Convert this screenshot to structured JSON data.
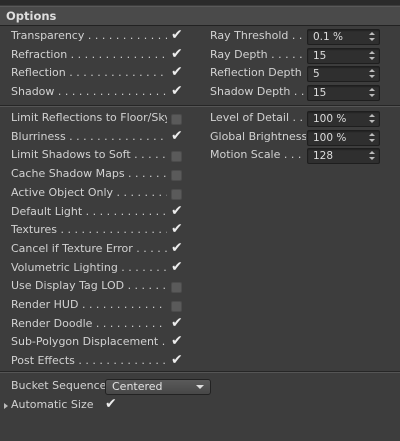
{
  "header": {
    "title": "Options"
  },
  "left_options": [
    {
      "label": "Transparency . . . . . . . . . . . .",
      "checked": true
    },
    {
      "label": "Refraction . . . . . . . . . . . . . . .",
      "checked": true
    },
    {
      "label": "Reflection . . . . . . . . . . . . . . .",
      "checked": true
    },
    {
      "label": "Shadow . . . . . . . . . . . . . . . . .",
      "checked": true
    }
  ],
  "right_fields_1": [
    {
      "label": "Ray Threshold . . .",
      "value": "0.1 %"
    },
    {
      "label": "Ray Depth . . . . . .",
      "value": "15"
    },
    {
      "label": "Reflection Depth",
      "value": "5"
    },
    {
      "label": "Shadow Depth . . .",
      "value": "15"
    }
  ],
  "left_options_2": [
    {
      "label": "Limit Reflections to Floor/Sky",
      "checked": false
    },
    {
      "label": "Blurriness . . . . . . . . . . . . . . .",
      "checked": true
    },
    {
      "label": "Limit Shadows to Soft . . . . . .",
      "checked": false
    },
    {
      "label": "Cache Shadow Maps . . . . . . . .",
      "checked": false
    },
    {
      "label": "Active Object Only . . . . . . . .",
      "checked": false
    },
    {
      "label": "Default Light . . . . . . . . . . . . . .",
      "checked": true
    },
    {
      "label": "Textures . . . . . . . . . . . . . . . . .",
      "checked": true
    },
    {
      "label": "Cancel if Texture Error . . . . .",
      "checked": true
    },
    {
      "label": "Volumetric Lighting . . . . . . . . .",
      "checked": true
    },
    {
      "label": "Use Display Tag LOD . . . . . . .",
      "checked": false
    },
    {
      "label": "Render HUD . . . . . . . . . . . . . .",
      "checked": false
    },
    {
      "label": "Render Doodle . . . . . . . . . . . .",
      "checked": true
    },
    {
      "label": "Sub-Polygon Displacement . .",
      "checked": true
    },
    {
      "label": "Post Effects . . . . . . . . . . . . .",
      "checked": true
    }
  ],
  "right_fields_2": [
    {
      "label": "Level of Detail . . .",
      "value": "100 %"
    },
    {
      "label": "Global Brightness",
      "value": "100 %"
    },
    {
      "label": "Motion Scale . . . .",
      "value": "128"
    }
  ],
  "bucket": {
    "label": "Bucket Sequence",
    "value": "Centered"
  },
  "auto_size": {
    "label": "Automatic Size",
    "checked": true
  }
}
